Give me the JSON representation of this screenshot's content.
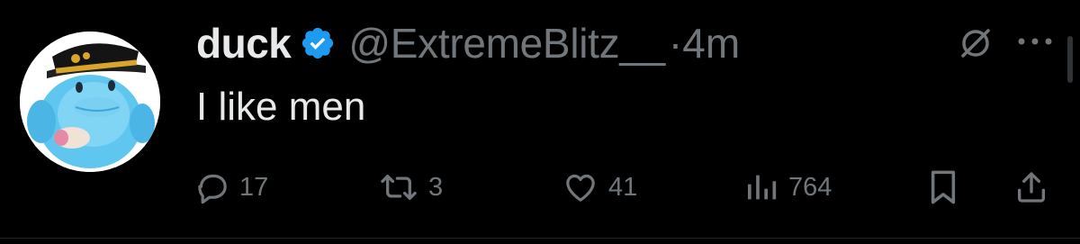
{
  "author": {
    "display_name": "duck",
    "handle": "@ExtremeBlitz__",
    "separator": "·",
    "time": "4m",
    "verified": true,
    "avatar": "blue-duck-with-captain-hat"
  },
  "tweet": {
    "text": "I like men"
  },
  "actions": {
    "replies": "17",
    "reposts": "3",
    "likes": "41",
    "views": "764"
  },
  "icons": {
    "grok": "grok-icon",
    "more": "more-icon",
    "reply": "reply-icon",
    "repost": "repost-icon",
    "like": "heart-icon",
    "views": "views-icon",
    "bookmark": "bookmark-icon",
    "share": "share-icon"
  },
  "colors": {
    "background": "#000000",
    "primary_text": "#e7e9ea",
    "secondary_text": "#71767b",
    "verified_blue": "#1d9bf0"
  }
}
